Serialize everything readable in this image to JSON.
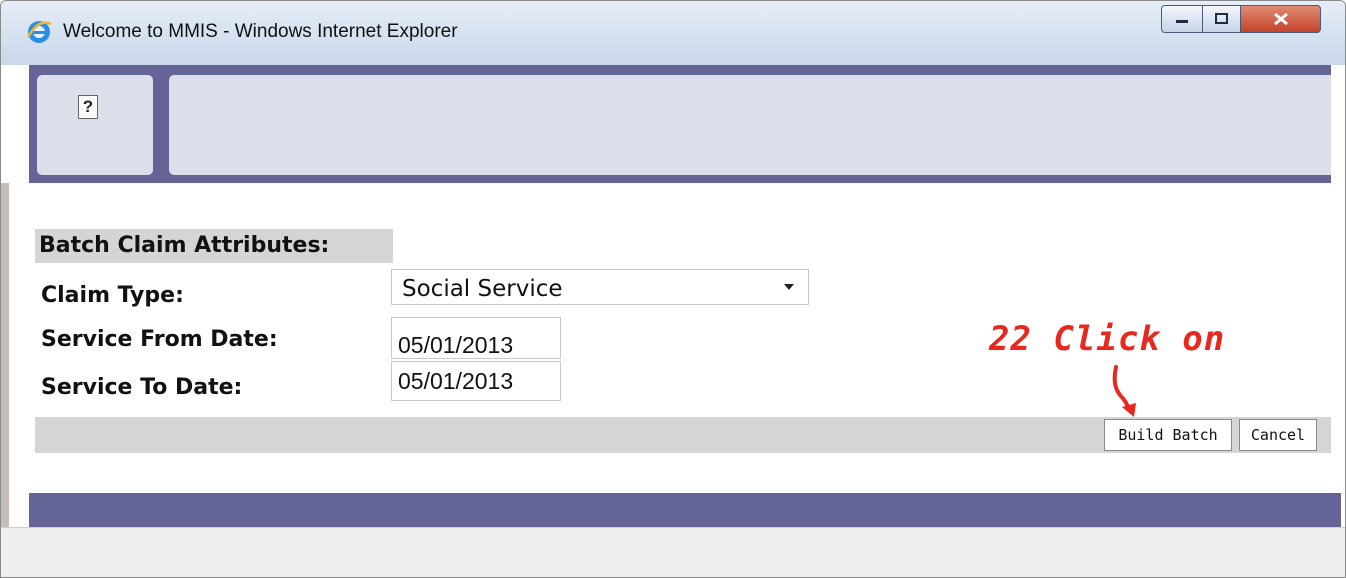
{
  "window": {
    "title": "Welcome to MMIS - Windows Internet Explorer",
    "icons": [
      "ie-icon",
      "minimize-icon",
      "maximize-icon",
      "close-icon"
    ]
  },
  "header": {
    "help_label": "?"
  },
  "form": {
    "section_title": "Batch Claim Attributes:",
    "claim_type_label": "Claim Type:",
    "claim_type_value": "Social Service",
    "service_from_label": "Service From Date:",
    "service_from_value": "05/01/2013",
    "service_to_label": "Service To Date:",
    "service_to_value": "05/01/2013"
  },
  "actions": {
    "build_batch": "Build Batch",
    "cancel": "Cancel"
  },
  "annotation": {
    "text": "22 Click on",
    "color": "#e8271f"
  },
  "colors": {
    "header_band": "#656497",
    "panel": "#dcdfea",
    "section_bg": "#d5d5d5"
  }
}
